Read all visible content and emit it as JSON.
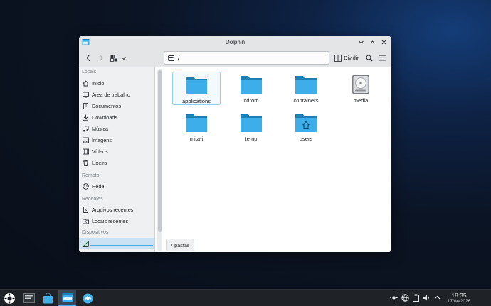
{
  "window": {
    "title": "Dolphin"
  },
  "toolbar": {
    "location_path": "/",
    "split_label": "Dividir"
  },
  "sidebar": {
    "sections": {
      "locais": "Locais",
      "remoto": "Remoto",
      "recentes": "Recentes",
      "dispositivos": "Dispositivos"
    },
    "places": [
      {
        "label": "Início",
        "icon": "home-icon"
      },
      {
        "label": "Área de trabalho",
        "icon": "desktop-icon"
      },
      {
        "label": "Documentos",
        "icon": "documents-icon"
      },
      {
        "label": "Downloads",
        "icon": "downloads-icon"
      },
      {
        "label": "Música",
        "icon": "music-icon"
      },
      {
        "label": "Imagens",
        "icon": "images-icon"
      },
      {
        "label": "Vídeos",
        "icon": "videos-icon"
      },
      {
        "label": "Lixeira",
        "icon": "trash-icon"
      }
    ],
    "remote": [
      {
        "label": "Rede",
        "icon": "network-icon"
      }
    ],
    "recent": [
      {
        "label": "Arquivos recentes",
        "icon": "recent-files-icon"
      },
      {
        "label": "Locais recentes",
        "icon": "recent-places-icon"
      }
    ]
  },
  "files": [
    {
      "name": "applications",
      "type": "folder"
    },
    {
      "name": "cdrom",
      "type": "folder"
    },
    {
      "name": "containers",
      "type": "folder"
    },
    {
      "name": "media",
      "type": "drive"
    },
    {
      "name": "mita-i",
      "type": "folder"
    },
    {
      "name": "temp",
      "type": "folder"
    },
    {
      "name": "users",
      "type": "home-folder"
    }
  ],
  "status": {
    "text": "7 pastas"
  },
  "clock": {
    "time": "18:35",
    "date": "17/04/2026"
  },
  "colors": {
    "accent": "#3daee9",
    "folder": "#3daee9",
    "folder_dark": "#1d7fb3"
  }
}
